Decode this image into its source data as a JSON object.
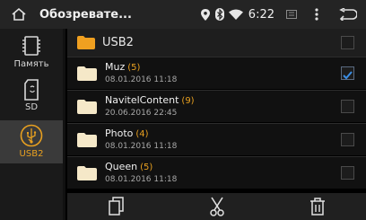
{
  "statusbar": {
    "title": "Обозревате...",
    "time": "6:22",
    "icons": [
      "home-icon",
      "location-pin-icon",
      "bluetooth-icon",
      "wifi-icon",
      "sd-card-status-icon",
      "overflow-menu-icon",
      "back-icon"
    ]
  },
  "sidebar": {
    "items": [
      {
        "label": "Память",
        "icon": "memory-chip-icon"
      },
      {
        "label": "SD",
        "icon": "sd-card-icon"
      },
      {
        "label": "USB2",
        "icon": "usb-icon",
        "active": true
      }
    ],
    "accent_color": "#e8a020"
  },
  "list": {
    "current_folder": "USB2",
    "rows": [
      {
        "name": "Muz",
        "count": "(5)",
        "date": "08.01.2016 11:18",
        "checked": true
      },
      {
        "name": "NavitelContent",
        "count": "(9)",
        "date": "20.06.2016 22:45",
        "checked": false
      },
      {
        "name": "Photo",
        "count": "(4)",
        "date": "08.01.2016 11:18",
        "checked": false
      },
      {
        "name": "Queen",
        "count": "(5)",
        "date": "08.01.2016 11:18",
        "checked": false
      }
    ]
  },
  "toolbar": {
    "buttons": [
      "copy-icon",
      "cut-icon",
      "delete-icon"
    ]
  },
  "colors": {
    "folder_orange": "#f0a020",
    "folder_light": "#f5e8c8",
    "count_orange": "#e8a020",
    "check_blue": "#3a8ee6"
  }
}
